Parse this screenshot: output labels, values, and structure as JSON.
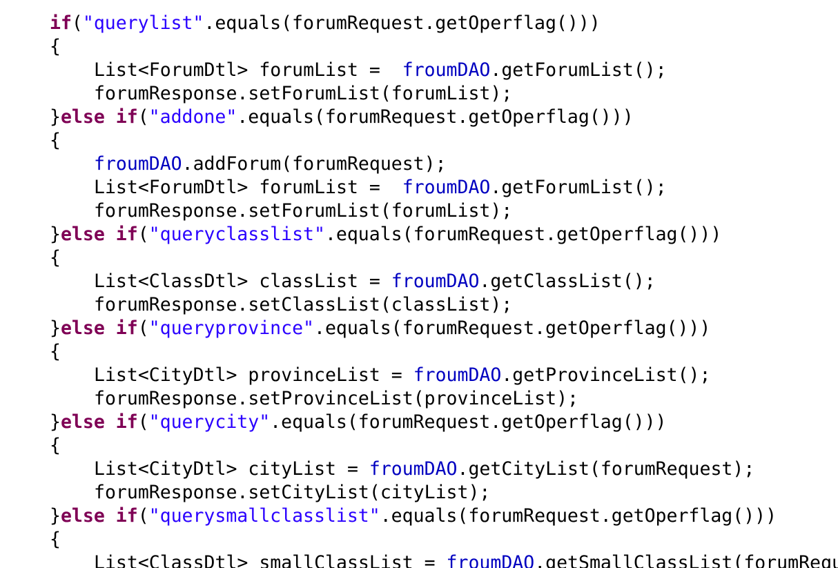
{
  "theme": {
    "background": "#ffffff",
    "plain": "#000000",
    "keyword": "#7f0055",
    "string": "#2a00ff",
    "field": "#0000c0"
  },
  "code": {
    "lines": [
      {
        "indent": 0,
        "tokens": [
          {
            "t": "kw",
            "v": "if"
          },
          {
            "t": "pln",
            "v": "("
          },
          {
            "t": "str",
            "v": "\"querylist\""
          },
          {
            "t": "pln",
            "v": ".equals(forumRequest.getOperflag()))"
          }
        ]
      },
      {
        "indent": 0,
        "tokens": [
          {
            "t": "pln",
            "v": "{"
          }
        ]
      },
      {
        "indent": 1,
        "tokens": [
          {
            "t": "pln",
            "v": "List<ForumDtl> forumList =  "
          },
          {
            "t": "fld",
            "v": "froumDAO"
          },
          {
            "t": "pln",
            "v": ".getForumList();"
          }
        ]
      },
      {
        "indent": 1,
        "tokens": [
          {
            "t": "pln",
            "v": "forumResponse.setForumList(forumList);"
          }
        ]
      },
      {
        "indent": 0,
        "tokens": [
          {
            "t": "pln",
            "v": "}"
          },
          {
            "t": "kw",
            "v": "else"
          },
          {
            "t": "pln",
            "v": " "
          },
          {
            "t": "kw",
            "v": "if"
          },
          {
            "t": "pln",
            "v": "("
          },
          {
            "t": "str",
            "v": "\"addone\""
          },
          {
            "t": "pln",
            "v": ".equals(forumRequest.getOperflag()))"
          }
        ]
      },
      {
        "indent": 0,
        "tokens": [
          {
            "t": "pln",
            "v": "{"
          }
        ]
      },
      {
        "indent": 1,
        "tokens": [
          {
            "t": "fld",
            "v": "froumDAO"
          },
          {
            "t": "pln",
            "v": ".addForum(forumRequest);"
          }
        ]
      },
      {
        "indent": 1,
        "tokens": [
          {
            "t": "pln",
            "v": "List<ForumDtl> forumList =  "
          },
          {
            "t": "fld",
            "v": "froumDAO"
          },
          {
            "t": "pln",
            "v": ".getForumList();"
          }
        ]
      },
      {
        "indent": 1,
        "tokens": [
          {
            "t": "pln",
            "v": "forumResponse.setForumList(forumList);"
          }
        ]
      },
      {
        "indent": 0,
        "tokens": [
          {
            "t": "pln",
            "v": "}"
          },
          {
            "t": "kw",
            "v": "else"
          },
          {
            "t": "pln",
            "v": " "
          },
          {
            "t": "kw",
            "v": "if"
          },
          {
            "t": "pln",
            "v": "("
          },
          {
            "t": "str",
            "v": "\"queryclasslist\""
          },
          {
            "t": "pln",
            "v": ".equals(forumRequest.getOperflag()))"
          }
        ]
      },
      {
        "indent": 0,
        "tokens": [
          {
            "t": "pln",
            "v": "{"
          }
        ]
      },
      {
        "indent": 1,
        "tokens": [
          {
            "t": "pln",
            "v": "List<ClassDtl> classList = "
          },
          {
            "t": "fld",
            "v": "froumDAO"
          },
          {
            "t": "pln",
            "v": ".getClassList();"
          }
        ]
      },
      {
        "indent": 1,
        "tokens": [
          {
            "t": "pln",
            "v": "forumResponse.setClassList(classList);"
          }
        ]
      },
      {
        "indent": 0,
        "tokens": [
          {
            "t": "pln",
            "v": "}"
          },
          {
            "t": "kw",
            "v": "else"
          },
          {
            "t": "pln",
            "v": " "
          },
          {
            "t": "kw",
            "v": "if"
          },
          {
            "t": "pln",
            "v": "("
          },
          {
            "t": "str",
            "v": "\"queryprovince\""
          },
          {
            "t": "pln",
            "v": ".equals(forumRequest.getOperflag()))"
          }
        ]
      },
      {
        "indent": 0,
        "tokens": [
          {
            "t": "pln",
            "v": "{"
          }
        ]
      },
      {
        "indent": 1,
        "tokens": [
          {
            "t": "pln",
            "v": "List<CityDtl> provinceList = "
          },
          {
            "t": "fld",
            "v": "froumDAO"
          },
          {
            "t": "pln",
            "v": ".getProvinceList();"
          }
        ]
      },
      {
        "indent": 1,
        "tokens": [
          {
            "t": "pln",
            "v": "forumResponse.setProvinceList(provinceList);"
          }
        ]
      },
      {
        "indent": 0,
        "tokens": [
          {
            "t": "pln",
            "v": "}"
          },
          {
            "t": "kw",
            "v": "else"
          },
          {
            "t": "pln",
            "v": " "
          },
          {
            "t": "kw",
            "v": "if"
          },
          {
            "t": "pln",
            "v": "("
          },
          {
            "t": "str",
            "v": "\"querycity\""
          },
          {
            "t": "pln",
            "v": ".equals(forumRequest.getOperflag()))"
          }
        ]
      },
      {
        "indent": 0,
        "tokens": [
          {
            "t": "pln",
            "v": "{"
          }
        ]
      },
      {
        "indent": 1,
        "tokens": [
          {
            "t": "pln",
            "v": "List<CityDtl> cityList = "
          },
          {
            "t": "fld",
            "v": "froumDAO"
          },
          {
            "t": "pln",
            "v": ".getCityList(forumRequest);"
          }
        ]
      },
      {
        "indent": 1,
        "tokens": [
          {
            "t": "pln",
            "v": "forumResponse.setCityList(cityList);"
          }
        ]
      },
      {
        "indent": 0,
        "tokens": [
          {
            "t": "pln",
            "v": "}"
          },
          {
            "t": "kw",
            "v": "else"
          },
          {
            "t": "pln",
            "v": " "
          },
          {
            "t": "kw",
            "v": "if"
          },
          {
            "t": "pln",
            "v": "("
          },
          {
            "t": "str",
            "v": "\"querysmallclasslist\""
          },
          {
            "t": "pln",
            "v": ".equals(forumRequest.getOperflag()))"
          }
        ]
      },
      {
        "indent": 0,
        "tokens": [
          {
            "t": "pln",
            "v": "{"
          }
        ]
      },
      {
        "indent": 1,
        "tokens": [
          {
            "t": "pln",
            "v": "List<ClassDtl> smallClassList = "
          },
          {
            "t": "fld",
            "v": "froumDAO"
          },
          {
            "t": "pln",
            "v": ".getSmallClassList(forumRequ"
          }
        ]
      }
    ]
  }
}
